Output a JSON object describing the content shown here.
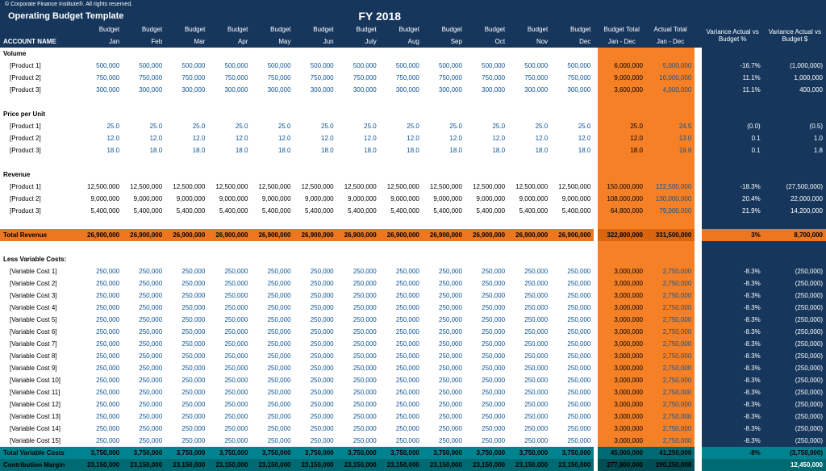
{
  "copyright": "© Corporate Finance Institute®. All rights reserved.",
  "title": "Operating Budget Template",
  "fy": "FY 2018",
  "headerTop": {
    "month": "Budget",
    "budgetTotal": "Budget Total",
    "actualTotal": "Actual Total",
    "varPct": "Variance Actual vs Budget %",
    "varAmt": "Variance Actual vs Budget $"
  },
  "headerBottom": {
    "account": "ACCOUNT NAME",
    "months": [
      "Jan",
      "Feb",
      "Mar",
      "Apr",
      "May",
      "Jun",
      "July",
      "Aug",
      "Sep",
      "Oct",
      "Nov",
      "Dec"
    ],
    "range": "Jan - Dec"
  },
  "sections": [
    {
      "name": "Volume",
      "rows": [
        {
          "label": "[Product 1]",
          "month": "500,000",
          "color": "blue",
          "bt": "6,000,000",
          "at": "5,000,000",
          "vp": "-16.7%",
          "va": "(1,000,000)"
        },
        {
          "label": "[Product 2]",
          "month": "750,000",
          "color": "blue",
          "bt": "9,000,000",
          "at": "10,000,000",
          "vp": "11.1%",
          "va": "1,000,000"
        },
        {
          "label": "[Product 3]",
          "month": "300,000",
          "color": "blue",
          "bt": "3,600,000",
          "at": "4,000,000",
          "vp": "11.1%",
          "va": "400,000"
        }
      ]
    },
    {
      "name": "Price per Unit",
      "rows": [
        {
          "label": "[Product 1]",
          "month": "25.0",
          "color": "blue",
          "bt": "25.0",
          "at": "24.5",
          "vp": "(0.0)",
          "va": "(0.5)"
        },
        {
          "label": "[Product 2]",
          "month": "12.0",
          "color": "blue",
          "bt": "12.0",
          "at": "13.0",
          "vp": "0.1",
          "va": "1.0"
        },
        {
          "label": "[Product 3]",
          "month": "18.0",
          "color": "blue",
          "bt": "18.0",
          "at": "19.8",
          "vp": "0.1",
          "va": "1.8"
        }
      ]
    },
    {
      "name": "Revenue",
      "rows": [
        {
          "label": "[Product 1]",
          "month": "12,500,000",
          "color": "black",
          "bt": "150,000,000",
          "at": "122,500,000",
          "vp": "-18.3%",
          "va": "(27,500,000)"
        },
        {
          "label": "[Product 2]",
          "month": "9,000,000",
          "color": "black",
          "bt": "108,000,000",
          "at": "130,000,000",
          "vp": "20.4%",
          "va": "22,000,000"
        },
        {
          "label": "[Product 3]",
          "month": "5,400,000",
          "color": "black",
          "bt": "64,800,000",
          "at": "79,000,000",
          "vp": "21.9%",
          "va": "14,200,000"
        }
      ]
    }
  ],
  "totalRevenue": {
    "label": "Total Revenue",
    "month": "26,900,000",
    "bt": "322,800,000",
    "at": "331,500,000",
    "vp": "3%",
    "va": "8,700,000"
  },
  "varCostHeader": "Less Variable Costs:",
  "varCosts": [
    "[Variable Cost 1]",
    "[Variable Cost 2]",
    "[Variable Cost 3]",
    "[Variable Cost 4]",
    "[Variable Cost 5]",
    "[Variable Cost 6]",
    "[Variable Cost 7]",
    "[Variable Cost 8]",
    "[Variable Cost 9]",
    "[Variable Cost 10]",
    "[Variable Cost 11]",
    "[Variable Cost 12]",
    "[Variable Cost 13]",
    "[Variable Cost 14]",
    "[Variable Cost 15]"
  ],
  "varCostRow": {
    "month": "250,000",
    "bt": "3,000,000",
    "at": "2,750,000",
    "vp": "-8.3%",
    "va": "(250,000)"
  },
  "totalVarCosts": {
    "label": "Total Variable Costs",
    "month": "3,750,000",
    "bt": "45,000,000",
    "at": "41,250,000",
    "vp": "-8%",
    "va": "(3,750,000)"
  },
  "contribMargin": {
    "label": "Contribution Margin",
    "month": "23,150,000",
    "bt": "277,800,000",
    "at": "290,250,000",
    "vp": "",
    "va": "12,450,000"
  }
}
